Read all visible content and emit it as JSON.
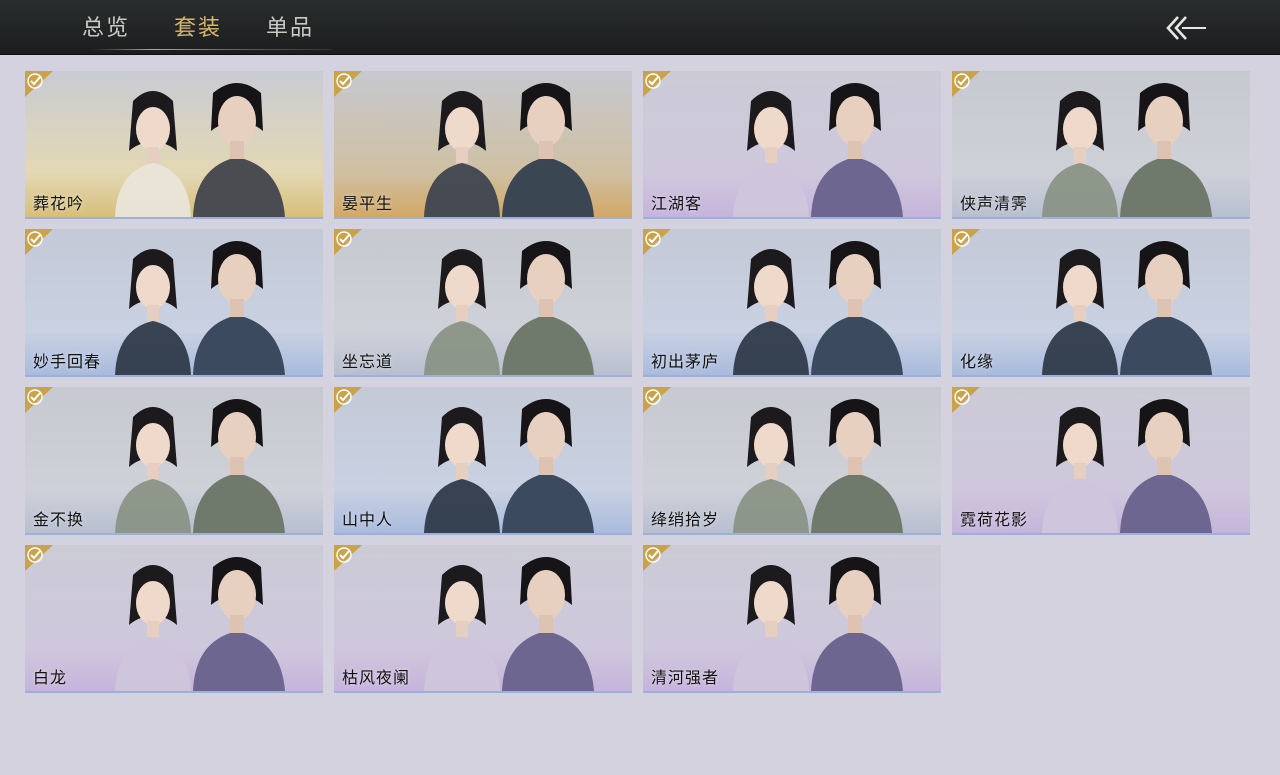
{
  "tabs": [
    {
      "label": "总览",
      "active": false
    },
    {
      "label": "套装",
      "active": true
    },
    {
      "label": "单品",
      "active": false
    }
  ],
  "back_icon": "double-chevron-left-arrow-icon",
  "check_icon": "checkmark-icon",
  "colors": {
    "accent_gold": "#d8b66a",
    "check_gold": "#c9a24a",
    "page_bg": "#d3d2de"
  },
  "outfits": [
    {
      "name": "葬花吟",
      "tone": "gold",
      "owned": true
    },
    {
      "name": "晏平生",
      "tone": "amber",
      "owned": true
    },
    {
      "name": "江湖客",
      "tone": "lavender",
      "owned": true
    },
    {
      "name": "侠声清霁",
      "tone": "grey",
      "owned": true
    },
    {
      "name": "妙手回春",
      "tone": "blue",
      "owned": true
    },
    {
      "name": "坐忘道",
      "tone": "grey",
      "owned": true
    },
    {
      "name": "初出茅庐",
      "tone": "blue",
      "owned": true
    },
    {
      "name": "化缘",
      "tone": "blue",
      "owned": true
    },
    {
      "name": "金不换",
      "tone": "grey",
      "owned": true
    },
    {
      "name": "山中人",
      "tone": "blue",
      "owned": true
    },
    {
      "name": "绛绡拾岁",
      "tone": "grey",
      "owned": true
    },
    {
      "name": "霓荷花影",
      "tone": "lavender",
      "owned": true
    },
    {
      "name": "白龙",
      "tone": "lavender",
      "owned": true
    },
    {
      "name": "枯风夜阑",
      "tone": "lavender",
      "owned": true
    },
    {
      "name": "清河强者",
      "tone": "lavender",
      "owned": true
    }
  ]
}
